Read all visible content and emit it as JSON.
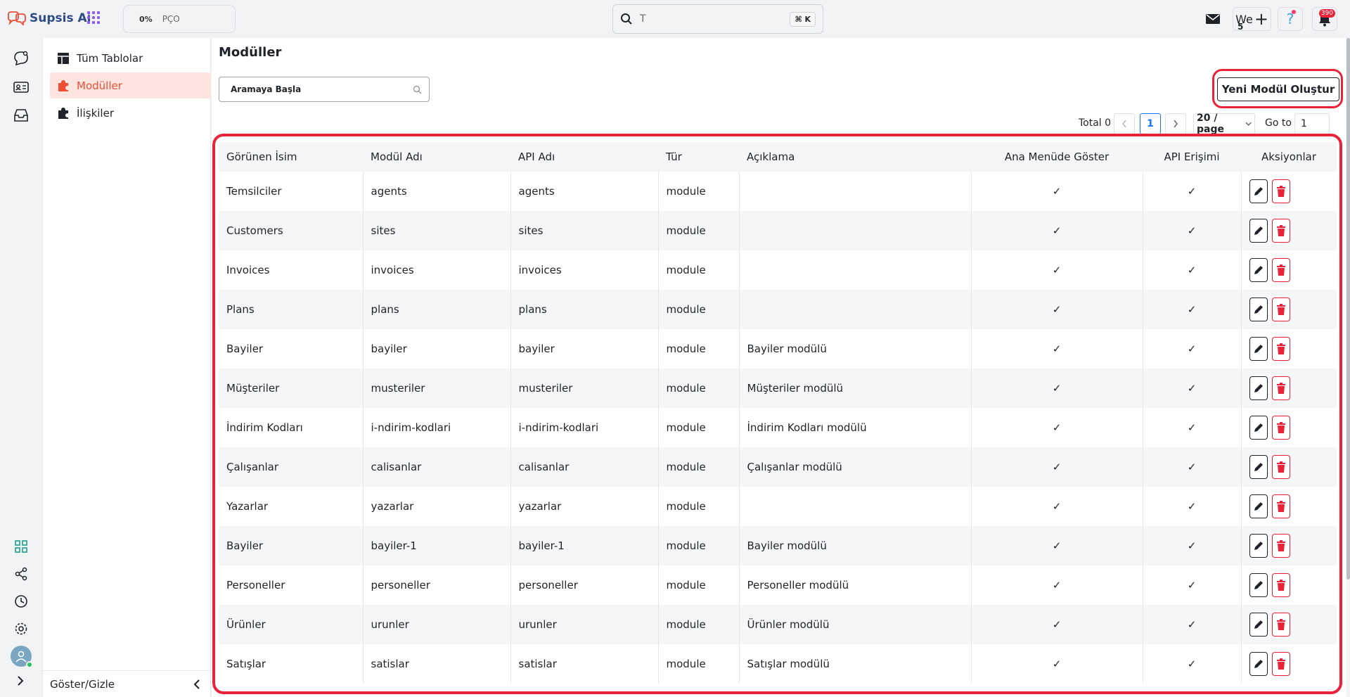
{
  "app": {
    "name": "Supsis Ai"
  },
  "topbar": {
    "progress_pct": "0%",
    "progress_code": "PÇO",
    "search_value": "T",
    "search_shortcut": "⌘ K",
    "workspace_label": "We",
    "workspace_count": "5",
    "notification_count": "390"
  },
  "sidebar": {
    "items": [
      {
        "label": "Tüm Tablolar"
      },
      {
        "label": "Modüller"
      },
      {
        "label": "İlişkiler"
      }
    ],
    "toggle_label": "Göster/Gizle"
  },
  "main": {
    "title": "Modüller",
    "search_placeholder": "Aramaya Başla",
    "new_button_label": "Yeni Modül Oluştur",
    "pagination": {
      "total_label": "Total 0",
      "current_page": "1",
      "page_size": "20 / page",
      "goto_label": "Go to",
      "goto_value": "1"
    }
  },
  "table": {
    "headers": [
      "Görünen İsim",
      "Modül Adı",
      "API Adı",
      "Tür",
      "Açıklama",
      "Ana Menüde Göster",
      "API Erişimi",
      "Aksiyonlar"
    ],
    "rows": [
      [
        "Temsilciler",
        "agents",
        "agents",
        "module",
        ""
      ],
      [
        "Customers",
        "sites",
        "sites",
        "module",
        ""
      ],
      [
        "Invoices",
        "invoices",
        "invoices",
        "module",
        ""
      ],
      [
        "Plans",
        "plans",
        "plans",
        "module",
        ""
      ],
      [
        "Bayiler",
        "bayiler",
        "bayiler",
        "module",
        "Bayiler modülü"
      ],
      [
        "Müşteriler",
        "musteriler",
        "musteriler",
        "module",
        "Müşteriler modülü"
      ],
      [
        "İndirim Kodları",
        "i-ndirim-kodlari",
        "i-ndirim-kodlari",
        "module",
        "İndirim Kodları modülü"
      ],
      [
        "Çalışanlar",
        "calisanlar",
        "calisanlar",
        "module",
        "Çalışanlar modülü"
      ],
      [
        "Yazarlar",
        "yazarlar",
        "yazarlar",
        "module",
        ""
      ],
      [
        "Bayiler",
        "bayiler-1",
        "bayiler-1",
        "module",
        "Bayiler modülü"
      ],
      [
        "Personeller",
        "personeller",
        "personeller",
        "module",
        "Personeller modülü"
      ],
      [
        "Ürünler",
        "urunler",
        "urunler",
        "module",
        "Ürünler modülü"
      ],
      [
        "Satışlar",
        "satislar",
        "satislar",
        "module",
        "Satışlar modülü"
      ]
    ],
    "check_glyph": "✓"
  },
  "colors": {
    "accent": "#ee4e36",
    "highlight_ring": "#e8233a",
    "brand": "#2f4c87",
    "delete": "#e8233a"
  }
}
